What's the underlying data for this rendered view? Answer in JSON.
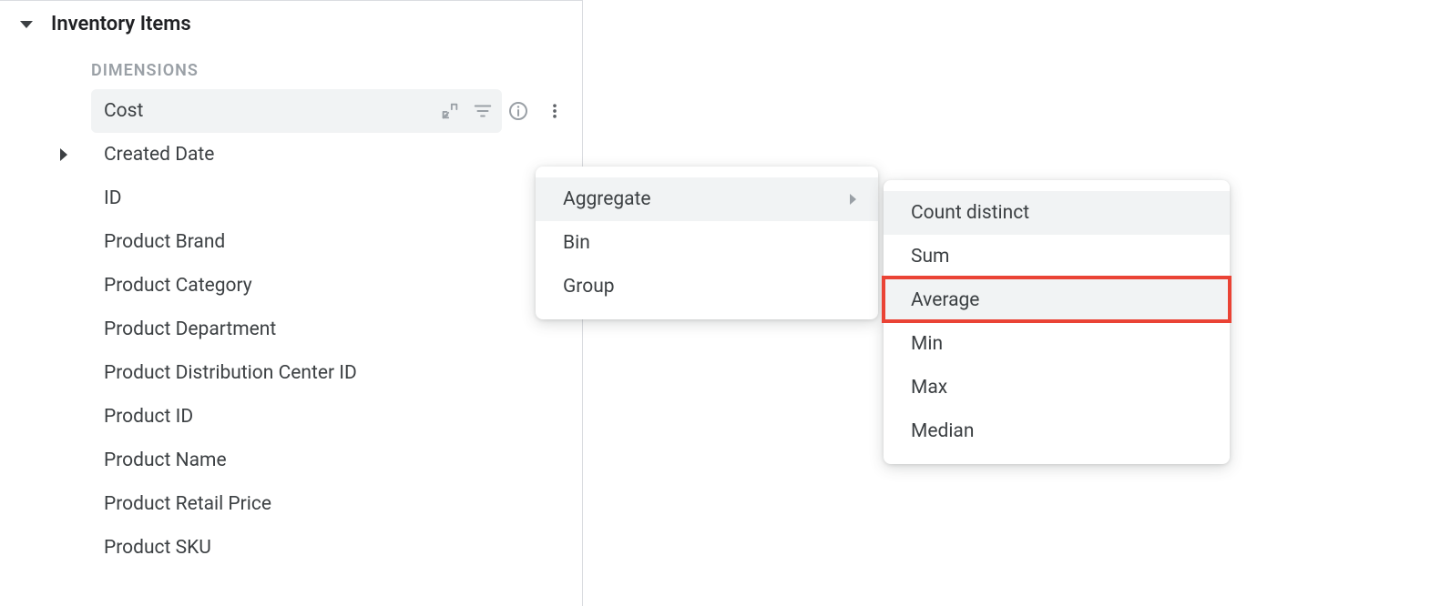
{
  "sidebar": {
    "group_title": "Inventory Items",
    "section_label": "DIMENSIONS",
    "items": [
      {
        "label": "Cost",
        "active": true,
        "expandable": false
      },
      {
        "label": "Created Date",
        "active": false,
        "expandable": true
      },
      {
        "label": "ID",
        "active": false,
        "expandable": false
      },
      {
        "label": "Product Brand",
        "active": false,
        "expandable": false
      },
      {
        "label": "Product Category",
        "active": false,
        "expandable": false
      },
      {
        "label": "Product Department",
        "active": false,
        "expandable": false
      },
      {
        "label": "Product Distribution Center ID",
        "active": false,
        "expandable": false
      },
      {
        "label": "Product ID",
        "active": false,
        "expandable": false
      },
      {
        "label": "Product Name",
        "active": false,
        "expandable": false
      },
      {
        "label": "Product Retail Price",
        "active": false,
        "expandable": false
      },
      {
        "label": "Product SKU",
        "active": false,
        "expandable": false
      }
    ]
  },
  "context_menu": {
    "items": [
      {
        "label": "Aggregate",
        "has_submenu": true,
        "hover": true
      },
      {
        "label": "Bin",
        "has_submenu": false,
        "hover": false
      },
      {
        "label": "Group",
        "has_submenu": false,
        "hover": false
      }
    ]
  },
  "submenu": {
    "items": [
      {
        "label": "Count distinct",
        "hover": true,
        "highlighted": false
      },
      {
        "label": "Sum",
        "hover": false,
        "highlighted": false
      },
      {
        "label": "Average",
        "hover": true,
        "highlighted": true
      },
      {
        "label": "Min",
        "hover": false,
        "highlighted": false
      },
      {
        "label": "Max",
        "hover": false,
        "highlighted": false
      },
      {
        "label": "Median",
        "hover": false,
        "highlighted": false
      }
    ]
  }
}
